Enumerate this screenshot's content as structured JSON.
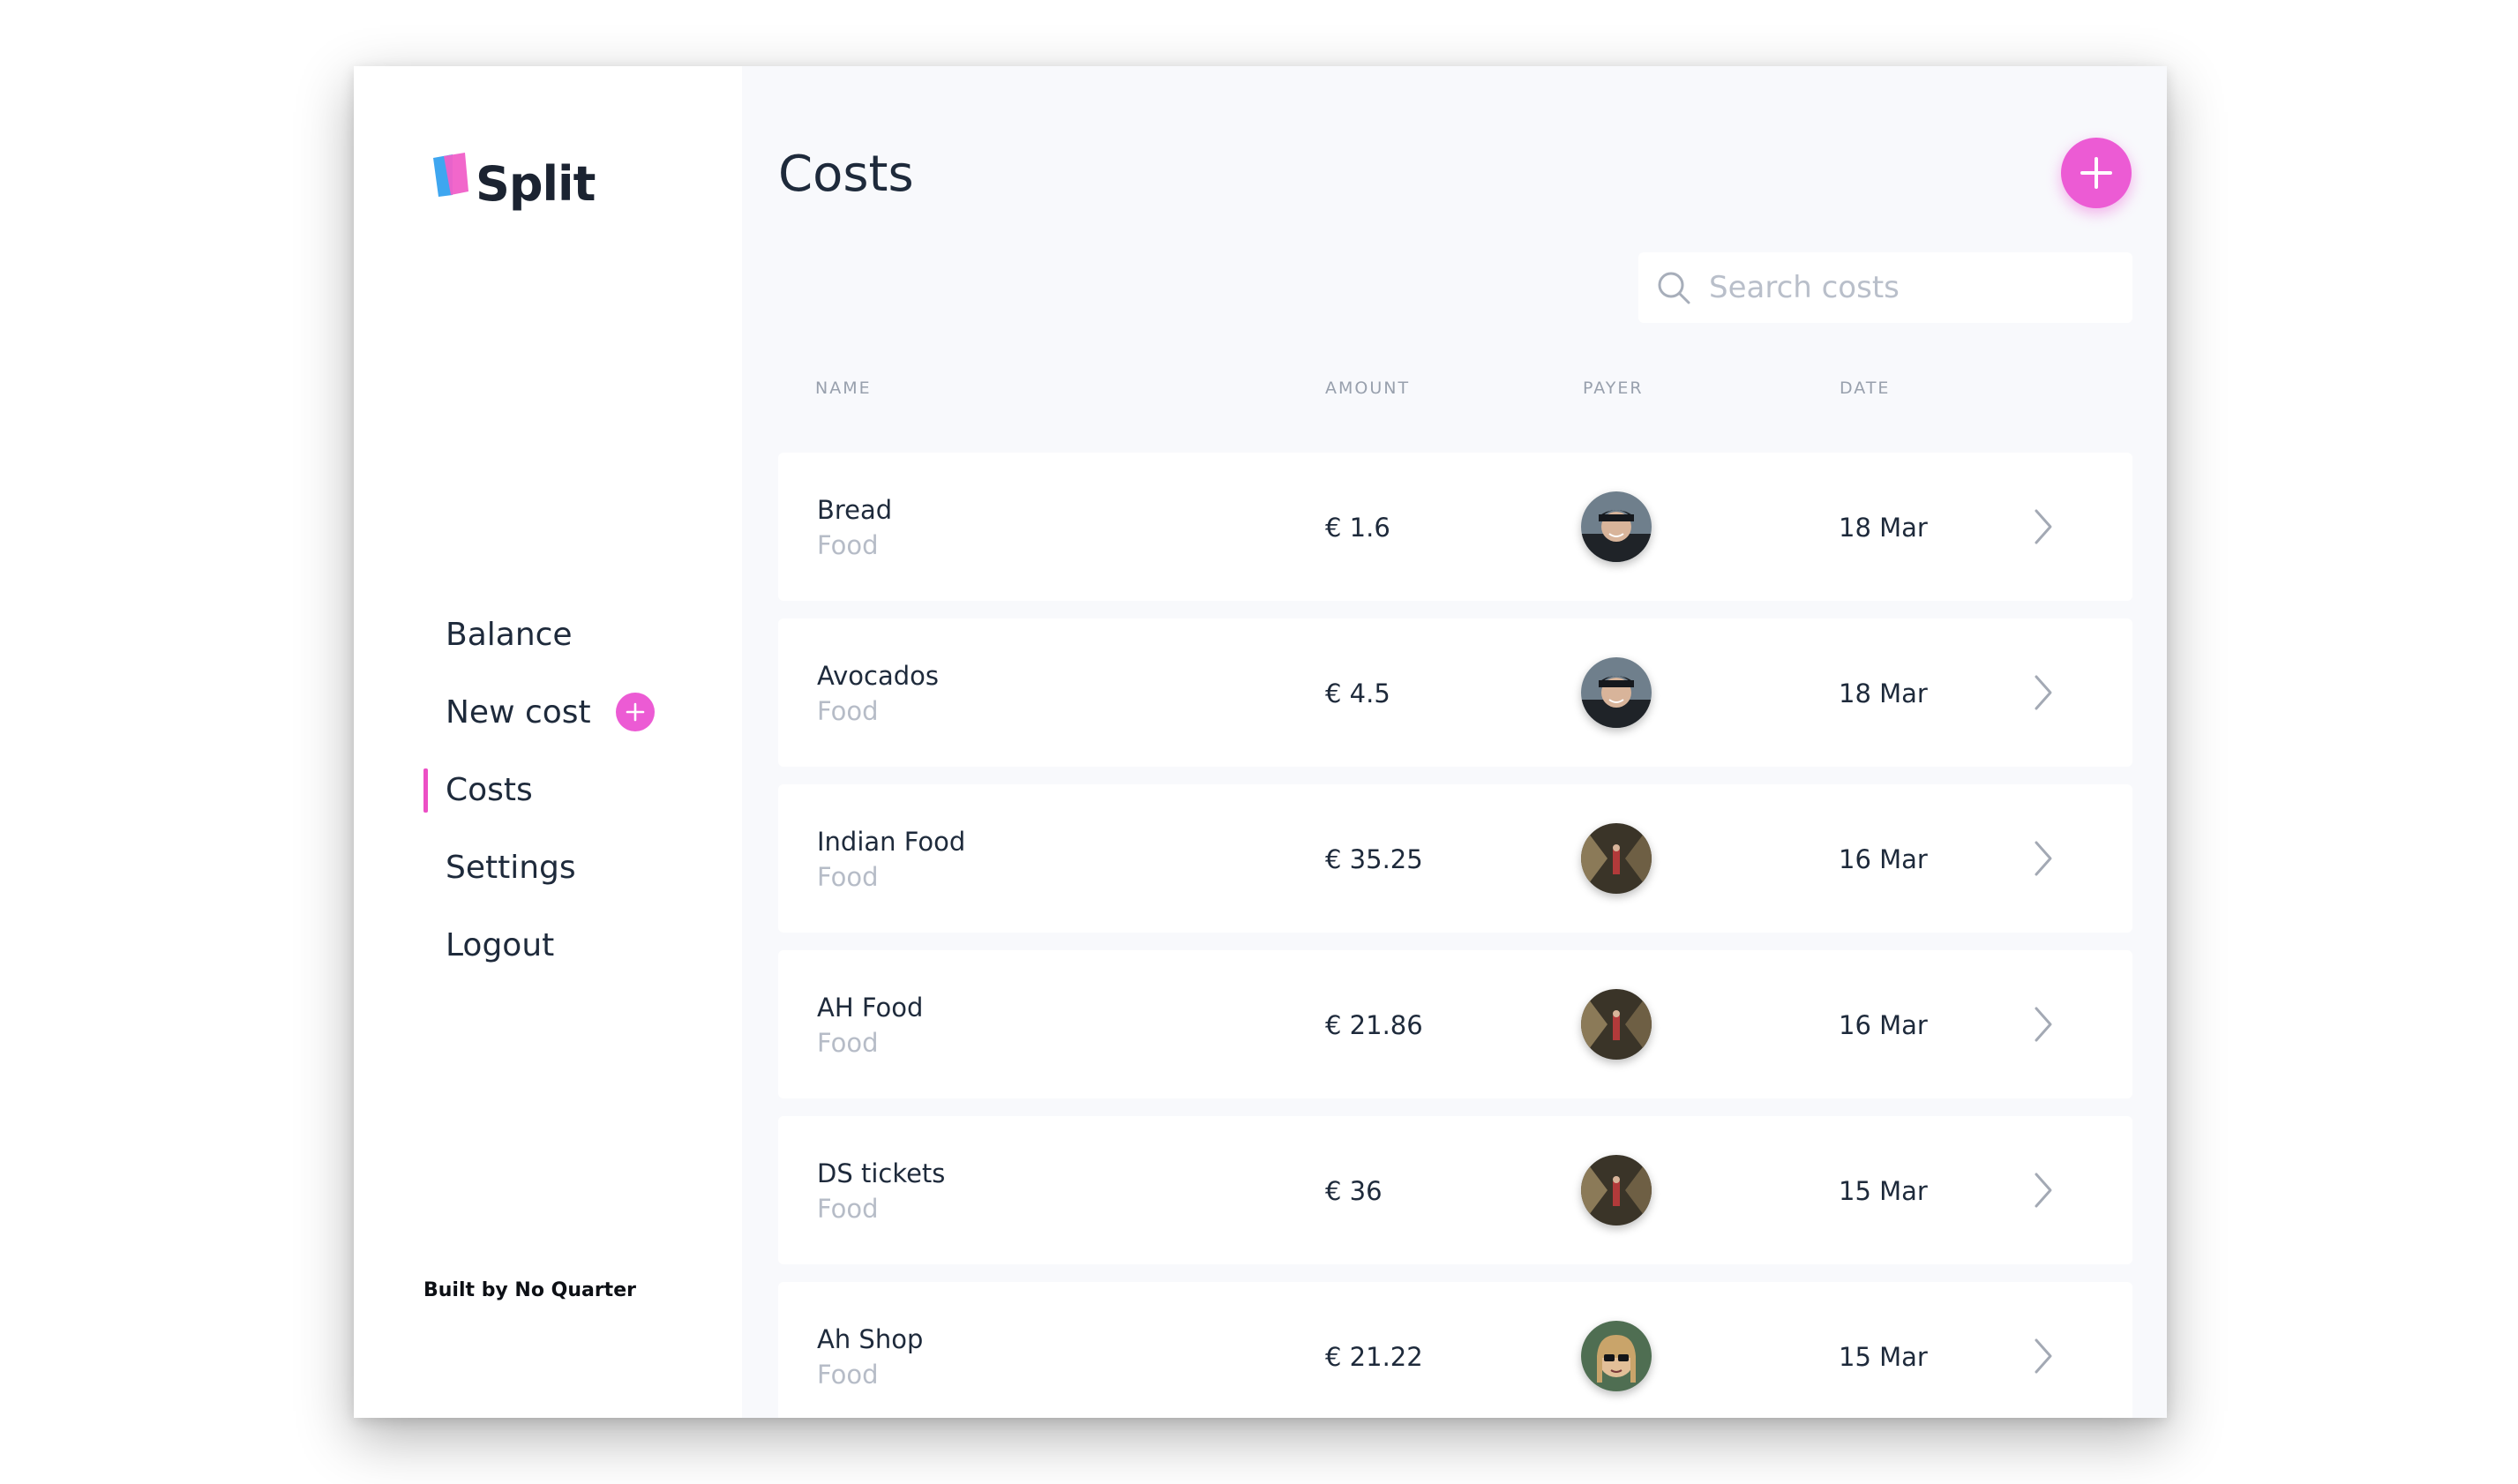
{
  "app": {
    "name": "Split",
    "brand_colors": {
      "accent": "#ec5bd4",
      "logo_pink": "#f05fc8",
      "logo_blue": "#3ea6f0"
    }
  },
  "sidebar": {
    "items": [
      {
        "label": "Balance",
        "active": false
      },
      {
        "label": "New cost",
        "active": false,
        "icon": "plus-icon"
      },
      {
        "label": "Costs",
        "active": true
      },
      {
        "label": "Settings",
        "active": false
      },
      {
        "label": "Logout",
        "active": false
      }
    ],
    "footer": "Built by No Quarter"
  },
  "main": {
    "title": "Costs",
    "add_button_icon": "plus-icon",
    "search": {
      "placeholder": "Search costs",
      "value": "",
      "icon": "search-icon"
    },
    "columns": [
      "NAME",
      "AMOUNT",
      "PAYER",
      "DATE"
    ],
    "rows": [
      {
        "name": "Bread",
        "category": "Food",
        "amount": "€ 1.6",
        "payer_avatar": "avatar-man-cap",
        "date": "18 Mar"
      },
      {
        "name": "Avocados",
        "category": "Food",
        "amount": "€ 4.5",
        "payer_avatar": "avatar-man-cap",
        "date": "18 Mar"
      },
      {
        "name": "Indian Food",
        "category": "Food",
        "amount": "€ 35.25",
        "payer_avatar": "avatar-tunnel",
        "date": "16 Mar"
      },
      {
        "name": "AH Food",
        "category": "Food",
        "amount": "€ 21.86",
        "payer_avatar": "avatar-tunnel",
        "date": "16 Mar"
      },
      {
        "name": "DS tickets",
        "category": "Food",
        "amount": "€ 36",
        "payer_avatar": "avatar-tunnel",
        "date": "15 Mar"
      },
      {
        "name": "Ah Shop",
        "category": "Food",
        "amount": "€ 21.22",
        "payer_avatar": "avatar-woman-sunglasses",
        "date": "15 Mar"
      }
    ]
  }
}
